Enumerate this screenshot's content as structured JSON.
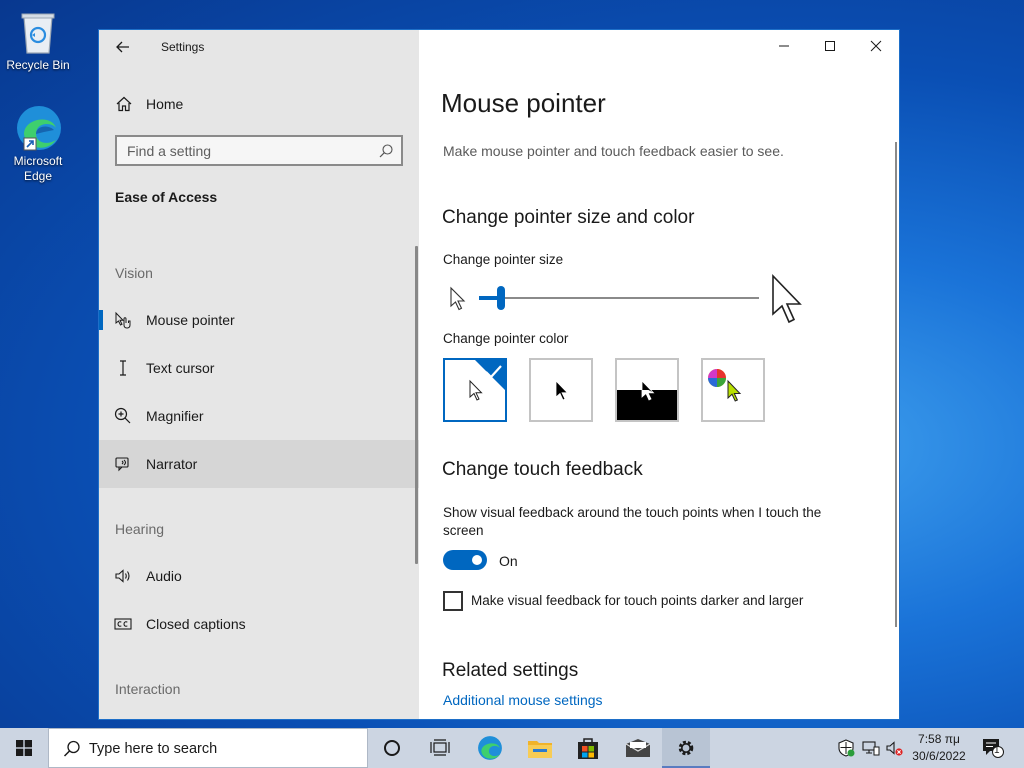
{
  "desktop": {
    "icons": [
      {
        "label": "Recycle Bin"
      },
      {
        "label": "Microsoft Edge"
      }
    ]
  },
  "window": {
    "app_title": "Settings",
    "sidebar": {
      "home_label": "Home",
      "search_placeholder": "Find a setting",
      "section_title": "Ease of Access",
      "groups": {
        "vision": "Vision",
        "hearing": "Hearing",
        "interaction": "Interaction"
      },
      "items": [
        {
          "label": "Mouse pointer",
          "icon": "mouse-pointer-icon",
          "selected": true
        },
        {
          "label": "Text cursor",
          "icon": "text-cursor-icon"
        },
        {
          "label": "Magnifier",
          "icon": "magnifier-icon"
        },
        {
          "label": "Narrator",
          "icon": "narrator-icon"
        },
        {
          "label": "Audio",
          "icon": "speaker-icon"
        },
        {
          "label": "Closed captions",
          "icon": "closed-captions-icon"
        }
      ]
    },
    "main": {
      "title": "Mouse pointer",
      "description": "Make mouse pointer and touch feedback easier to see.",
      "pointer_section": {
        "heading": "Change pointer size and color",
        "size_label": "Change pointer size",
        "size_value_fraction": 0.08,
        "color_label": "Change pointer color",
        "color_options": [
          {
            "name": "white",
            "selected": true
          },
          {
            "name": "black"
          },
          {
            "name": "inverted"
          },
          {
            "name": "custom"
          }
        ]
      },
      "touch_section": {
        "heading": "Change touch feedback",
        "show_feedback_label": "Show visual feedback around the touch points when I touch the screen",
        "toggle_state": "On",
        "darker_label": "Make visual feedback for touch points darker and larger",
        "darker_checked": false
      },
      "related": {
        "heading": "Related settings",
        "link": "Additional mouse settings"
      }
    }
  },
  "taskbar": {
    "search_text": "Type here to search",
    "clock_time": "7:58 πμ",
    "clock_date": "30/6/2022",
    "notification_count": "1",
    "accent": "#0067c0"
  }
}
